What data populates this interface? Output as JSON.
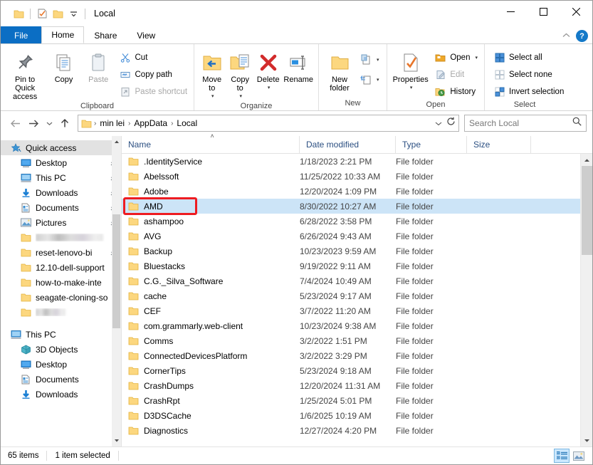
{
  "window": {
    "title": "Local",
    "quick_access_icons": [
      "folder-icon",
      "properties-icon",
      "new-folder-icon",
      "customize-qat-chevron-icon"
    ],
    "caption": {
      "minimize": "—",
      "maximize": "☐",
      "close": "✕"
    }
  },
  "ribbon": {
    "tabs": [
      {
        "label": "File",
        "id": "file"
      },
      {
        "label": "Home",
        "id": "home"
      },
      {
        "label": "Share",
        "id": "share"
      },
      {
        "label": "View",
        "id": "view"
      }
    ],
    "active_tab": "Home",
    "collapse_icon": "chevron-up-icon",
    "help_label": "?",
    "groups": [
      {
        "label": "Clipboard",
        "big_buttons": [
          {
            "label": "Pin to Quick access",
            "icon": "pin-icon",
            "disabled": false
          },
          {
            "label": "Copy",
            "icon": "copy-icon",
            "disabled": false
          },
          {
            "label": "Paste",
            "icon": "paste-icon",
            "disabled": true
          }
        ],
        "small_buttons": [
          {
            "label": "Cut",
            "icon": "scissors-icon",
            "disabled": false
          },
          {
            "label": "Copy path",
            "icon": "copy-path-icon",
            "disabled": false
          },
          {
            "label": "Paste shortcut",
            "icon": "paste-shortcut-icon",
            "disabled": true
          }
        ]
      },
      {
        "label": "Organize",
        "big_buttons": [
          {
            "label": "Move to",
            "icon": "move-to-icon",
            "dropdown": true
          },
          {
            "label": "Copy to",
            "icon": "copy-to-icon",
            "dropdown": true
          },
          {
            "label": "Delete",
            "icon": "delete-x-icon",
            "dropdown": true
          },
          {
            "label": "Rename",
            "icon": "rename-icon",
            "dropdown": false
          }
        ]
      },
      {
        "label": "New",
        "big_buttons": [
          {
            "label": "New folder",
            "icon": "new-folder-icon",
            "dropdown": false
          }
        ],
        "small_buttons": [
          {
            "label": "",
            "icon": "new-item-icon",
            "dropdown": true
          },
          {
            "label": "",
            "icon": "easy-access-icon",
            "dropdown": true
          }
        ]
      },
      {
        "label": "Open",
        "big_buttons": [
          {
            "label": "Properties",
            "icon": "properties-icon",
            "dropdown": true
          }
        ],
        "small_buttons": [
          {
            "label": "Open",
            "icon": "open-folder-icon",
            "dropdown": true,
            "disabled": false
          },
          {
            "label": "Edit",
            "icon": "edit-icon",
            "dropdown": false,
            "disabled": true
          },
          {
            "label": "History",
            "icon": "history-icon",
            "dropdown": false,
            "disabled": false
          }
        ]
      },
      {
        "label": "Select",
        "small_buttons": [
          {
            "label": "Select all",
            "icon": "select-all-icon"
          },
          {
            "label": "Select none",
            "icon": "select-none-icon"
          },
          {
            "label": "Invert selection",
            "icon": "invert-selection-icon"
          }
        ]
      }
    ]
  },
  "address": {
    "back_icon": "arrow-left-icon",
    "forward_icon": "arrow-right-icon",
    "recent_icon": "chevron-down-icon",
    "up_icon": "arrow-up-icon",
    "folder_icon": "folder-icon",
    "crumbs": [
      "min lei",
      "AppData",
      "Local"
    ],
    "separator": "›",
    "dropdown_icon": "chevron-down-icon",
    "refresh_icon": "refresh-icon",
    "search_placeholder": "Search Local",
    "search_value": "",
    "search_icon": "search-icon"
  },
  "sidebar": {
    "items": [
      {
        "label": "Quick access",
        "icon": "quick-access-star-icon",
        "level": 0,
        "selected": true,
        "pinned": false
      },
      {
        "label": "Desktop",
        "icon": "desktop-icon",
        "level": 1,
        "pinned": true
      },
      {
        "label": "This PC",
        "icon": "this-pc-icon",
        "level": 1,
        "pinned": true
      },
      {
        "label": "Downloads",
        "icon": "downloads-icon",
        "level": 1,
        "pinned": true
      },
      {
        "label": "Documents",
        "icon": "documents-icon",
        "level": 1,
        "pinned": true
      },
      {
        "label": "Pictures",
        "icon": "pictures-icon",
        "level": 1,
        "pinned": true
      },
      {
        "label": "",
        "icon": "folder-icon",
        "level": 1,
        "redacted": true,
        "redacted_width": 95
      },
      {
        "label": "reset-lenovo-bi",
        "icon": "folder-icon",
        "level": 1,
        "pinned": true
      },
      {
        "label": "12.10-dell-support",
        "icon": "folder-icon",
        "level": 1,
        "pinned": false
      },
      {
        "label": "how-to-make-inte",
        "icon": "folder-icon",
        "level": 1,
        "pinned": false
      },
      {
        "label": "seagate-cloning-so",
        "icon": "folder-icon",
        "level": 1,
        "pinned": false
      },
      {
        "label": "",
        "icon": "folder-icon",
        "level": 1,
        "redacted": true,
        "redacted_width": 42
      },
      {
        "label": "",
        "icon": "",
        "level": 0,
        "spacer": true
      },
      {
        "label": "This PC",
        "icon": "this-pc-icon",
        "level": 0,
        "pinned": false
      },
      {
        "label": "3D Objects",
        "icon": "3d-objects-icon",
        "level": 1,
        "pinned": false
      },
      {
        "label": "Desktop",
        "icon": "desktop-icon",
        "level": 1,
        "pinned": false
      },
      {
        "label": "Documents",
        "icon": "documents-icon",
        "level": 1,
        "pinned": false
      },
      {
        "label": "Downloads",
        "icon": "downloads-icon",
        "level": 1,
        "pinned": false
      }
    ]
  },
  "filelist": {
    "columns": [
      {
        "label": "Name",
        "key": "name",
        "sorted": true
      },
      {
        "label": "Date modified",
        "key": "date"
      },
      {
        "label": "Type",
        "key": "type"
      },
      {
        "label": "Size",
        "key": "size"
      }
    ],
    "sort_indicator": "˄",
    "rows": [
      {
        "name": ".IdentityService",
        "date": "1/18/2023 2:21 PM",
        "type": "File folder",
        "size": ""
      },
      {
        "name": "Abelssoft",
        "date": "11/25/2022 10:33 AM",
        "type": "File folder",
        "size": ""
      },
      {
        "name": "Adobe",
        "date": "12/20/2024 1:09 PM",
        "type": "File folder",
        "size": ""
      },
      {
        "name": "AMD",
        "date": "8/30/2022 10:27 AM",
        "type": "File folder",
        "size": "",
        "selected": true
      },
      {
        "name": "ashampoo",
        "date": "6/28/2022 3:58 PM",
        "type": "File folder",
        "size": ""
      },
      {
        "name": "AVG",
        "date": "6/26/2024 9:43 AM",
        "type": "File folder",
        "size": ""
      },
      {
        "name": "Backup",
        "date": "10/23/2023 9:59 AM",
        "type": "File folder",
        "size": ""
      },
      {
        "name": "Bluestacks",
        "date": "9/19/2022 9:11 AM",
        "type": "File folder",
        "size": ""
      },
      {
        "name": "C.G._Silva_Software",
        "date": "7/4/2024 10:49 AM",
        "type": "File folder",
        "size": ""
      },
      {
        "name": "cache",
        "date": "5/23/2024 9:17 AM",
        "type": "File folder",
        "size": ""
      },
      {
        "name": "CEF",
        "date": "3/7/2022 11:20 AM",
        "type": "File folder",
        "size": ""
      },
      {
        "name": "com.grammarly.web-client",
        "date": "10/23/2024 9:38 AM",
        "type": "File folder",
        "size": ""
      },
      {
        "name": "Comms",
        "date": "3/2/2022 1:51 PM",
        "type": "File folder",
        "size": ""
      },
      {
        "name": "ConnectedDevicesPlatform",
        "date": "3/2/2022 3:29 PM",
        "type": "File folder",
        "size": ""
      },
      {
        "name": "CornerTips",
        "date": "5/23/2024 9:18 AM",
        "type": "File folder",
        "size": ""
      },
      {
        "name": "CrashDumps",
        "date": "12/20/2024 11:31 AM",
        "type": "File folder",
        "size": ""
      },
      {
        "name": "CrashRpt",
        "date": "1/25/2024 5:01 PM",
        "type": "File folder",
        "size": ""
      },
      {
        "name": "D3DSCache",
        "date": "1/6/2025 10:19 AM",
        "type": "File folder",
        "size": ""
      },
      {
        "name": "Diagnostics",
        "date": "12/27/2024 4:20 PM",
        "type": "File folder",
        "size": ""
      }
    ],
    "highlight_row_name": "AMD"
  },
  "statusbar": {
    "item_count": "65 items",
    "selection": "1 item selected",
    "view_details_icon": "details-view-icon",
    "view_thumbs_icon": "large-icons-view-icon",
    "active_view": "details"
  },
  "colors": {
    "accent": "#0b6ec4",
    "selection": "#cce4f7",
    "highlight_box": "#ee1c21",
    "folder": "#fcd77f",
    "column_header_text": "#2b4f81"
  }
}
